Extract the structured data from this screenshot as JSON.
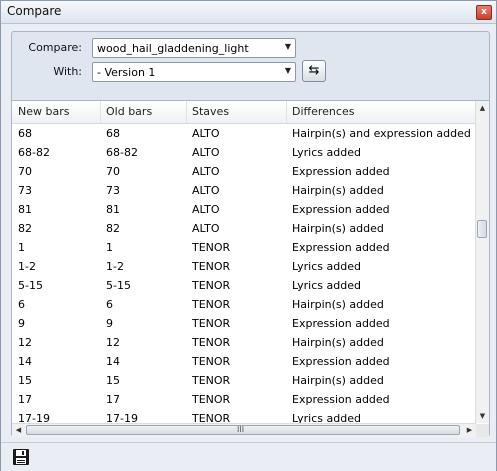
{
  "window": {
    "title": "Compare",
    "close_glyph": "x"
  },
  "compare": {
    "compare_label": "Compare:",
    "compare_value": "wood_hail_gladdening_light",
    "with_label": "With:",
    "with_value": "- Version 1",
    "swap_icon": "swap-arrows-icon"
  },
  "table": {
    "columns": [
      "New bars",
      "Old bars",
      "Staves",
      "Differences"
    ],
    "rows": [
      [
        "68",
        "68",
        "ALTO",
        "Hairpin(s) and expression added"
      ],
      [
        "68-82",
        "68-82",
        "ALTO",
        "Lyrics added"
      ],
      [
        "70",
        "70",
        "ALTO",
        "Expression added"
      ],
      [
        "73",
        "73",
        "ALTO",
        "Hairpin(s) added"
      ],
      [
        "81",
        "81",
        "ALTO",
        "Expression added"
      ],
      [
        "82",
        "82",
        "ALTO",
        "Hairpin(s) added"
      ],
      [
        "1",
        "1",
        "TENOR",
        "Expression added"
      ],
      [
        "1-2",
        "1-2",
        "TENOR",
        "Lyrics added"
      ],
      [
        "5-15",
        "5-15",
        "TENOR",
        "Lyrics added"
      ],
      [
        "6",
        "6",
        "TENOR",
        "Hairpin(s) added"
      ],
      [
        "9",
        "9",
        "TENOR",
        "Expression added"
      ],
      [
        "12",
        "12",
        "TENOR",
        "Hairpin(s) added"
      ],
      [
        "14",
        "14",
        "TENOR",
        "Expression added"
      ],
      [
        "15",
        "15",
        "TENOR",
        "Hairpin(s) added"
      ],
      [
        "17",
        "17",
        "TENOR",
        "Expression added"
      ],
      [
        "17-19",
        "17-19",
        "TENOR",
        "Lyrics added"
      ]
    ],
    "vscroll_position": 0.38,
    "hscroll_grip": "III"
  },
  "footer": {
    "save_icon": "save-disk-icon"
  }
}
